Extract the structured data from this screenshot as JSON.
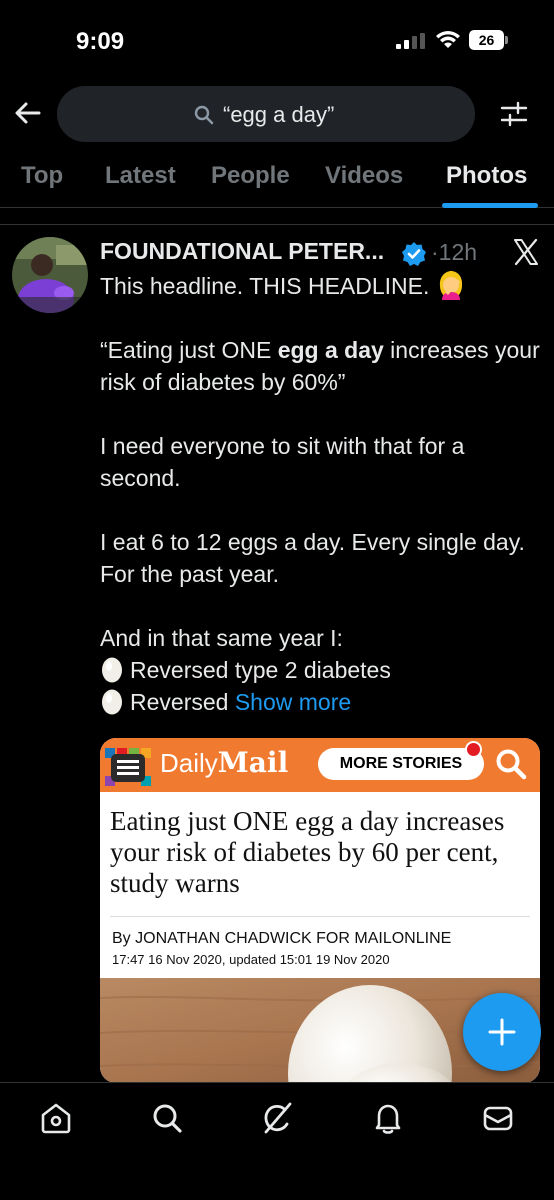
{
  "status_bar": {
    "time": "9:09",
    "battery": "26"
  },
  "search": {
    "query": "“egg a day”"
  },
  "tabs": [
    {
      "label": "Top"
    },
    {
      "label": "Latest"
    },
    {
      "label": "People"
    },
    {
      "label": "Videos"
    },
    {
      "label": "Photos",
      "active": true
    }
  ],
  "tweet": {
    "author": "FOUNDATIONAL PETER...",
    "separator": "·",
    "time": "12h",
    "line1": "This headline. THIS HEADLINE.",
    "quote_start": "“Eating just ONE ",
    "quote_bold": "egg a day",
    "quote_end": " increases your risk of diabetes by 60%”",
    "para3": "I need everyone to sit with that for a second.",
    "para4": "I eat 6 to 12 eggs a day. Every single day. For the past year.",
    "para5": "And in that same year I:",
    "bullet1": "Reversed type 2 diabetes",
    "bullet2": "Reversed",
    "show_more": "Show more"
  },
  "card": {
    "logo_daily": "Daily",
    "logo_mail": "Mail",
    "more_stories": "MORE STORIES",
    "headline": "Eating just ONE egg a day increases your risk of diabetes by 60 per cent, study warns",
    "byline": "By JONATHAN CHADWICK FOR MAILONLINE",
    "date": "17:47 16 Nov 2020, updated 15:01 19 Nov 2020"
  },
  "colors": {
    "accent": "#1d9bf0",
    "dailymail_orange": "#f07a2f"
  },
  "icons": [
    "back-arrow-icon",
    "search-icon",
    "filter-icon",
    "verified-badge-icon",
    "x-logo-icon",
    "egg-icon",
    "compose-plus-icon",
    "home-icon",
    "search-nav-icon",
    "grok-icon",
    "notifications-icon",
    "messages-icon"
  ]
}
